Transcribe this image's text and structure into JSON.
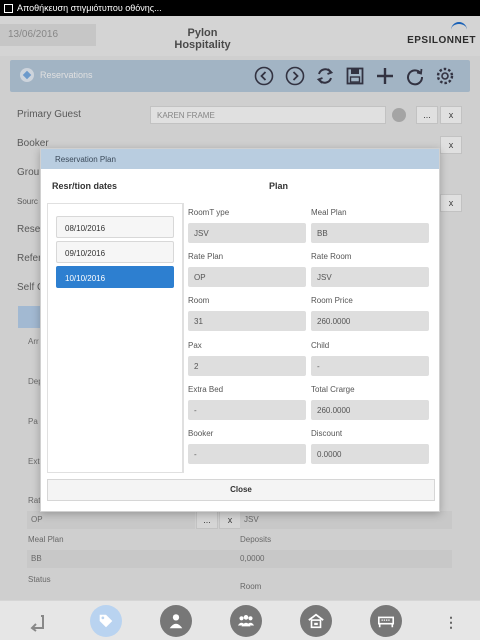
{
  "status_bar": {
    "text": "Αποθήκευση στιγμιότυπου οθόνης..."
  },
  "header": {
    "date": "13/06/2016",
    "title": "Pylon Hospitality",
    "logo": "EPSILONNET"
  },
  "toolbar": {
    "title": "Reservations",
    "icons": [
      "chevron-left-icon",
      "chevron-right-icon",
      "refresh-icon",
      "save-icon",
      "add-icon",
      "reload-icon",
      "settings-icon"
    ]
  },
  "form": {
    "primary_guest_label": "Primary Guest",
    "primary_guest_value": "KAREN FRAME",
    "booker_label": "Booker",
    "group_label": "Grou",
    "source_label": "Sourc",
    "reservation_label": "Rese",
    "reference_label": "Refer",
    "self_label": "Self C",
    "arrival_label": "Arr",
    "departure_label": "Dep",
    "pax_label": "Pa",
    "extra_label": "Ext",
    "rate_label": "Rat",
    "ellipsis": "...",
    "clear": "x",
    "rate_plan_value": "OP",
    "rate_room_value": "JSV",
    "meal_plan_label": "Meal Plan",
    "meal_plan_value": "BB",
    "deposits_label": "Deposits",
    "deposits_value": "0,0000",
    "status_label": "Status",
    "room_label": "Room"
  },
  "modal": {
    "title": "Reservation Plan",
    "dates_header": "Resr/tion dates",
    "plan_header": "Plan",
    "dates": [
      "08/10/2016",
      "09/10/2016",
      "10/10/2016"
    ],
    "selected_date_index": 2,
    "fields": {
      "room_type_label": "RoomT ype",
      "room_type_value": "JSV",
      "meal_plan_label": "Meal Plan",
      "meal_plan_value": "BB",
      "rate_plan_label": "Rate Plan",
      "rate_plan_value": "OP",
      "rate_room_label": "Rate Room",
      "rate_room_value": "JSV",
      "room_label": "Room",
      "room_value": "31",
      "room_price_label": "Room Price",
      "room_price_value": "260.0000",
      "pax_label": "Pax",
      "pax_value": "2",
      "child_label": "Child",
      "child_value": "-",
      "extra_bed_label": "Extra Bed",
      "extra_bed_value": "-",
      "total_charge_label": "Total Crarge",
      "total_charge_value": "260.0000",
      "booker_label": "Booker",
      "booker_value": "-",
      "discount_label": "Discount",
      "discount_value": "0.0000"
    },
    "close_label": "Close"
  },
  "bottom_nav": {
    "icons": [
      "back-icon",
      "tag-icon",
      "person-icon",
      "group-icon",
      "hotel-icon",
      "bed-icon",
      "more-icon"
    ],
    "more_label": "⋮"
  },
  "colors": {
    "accent": "#2d7fd0",
    "toolbar": "#b9cde0",
    "logo": "#1e6fd0"
  }
}
